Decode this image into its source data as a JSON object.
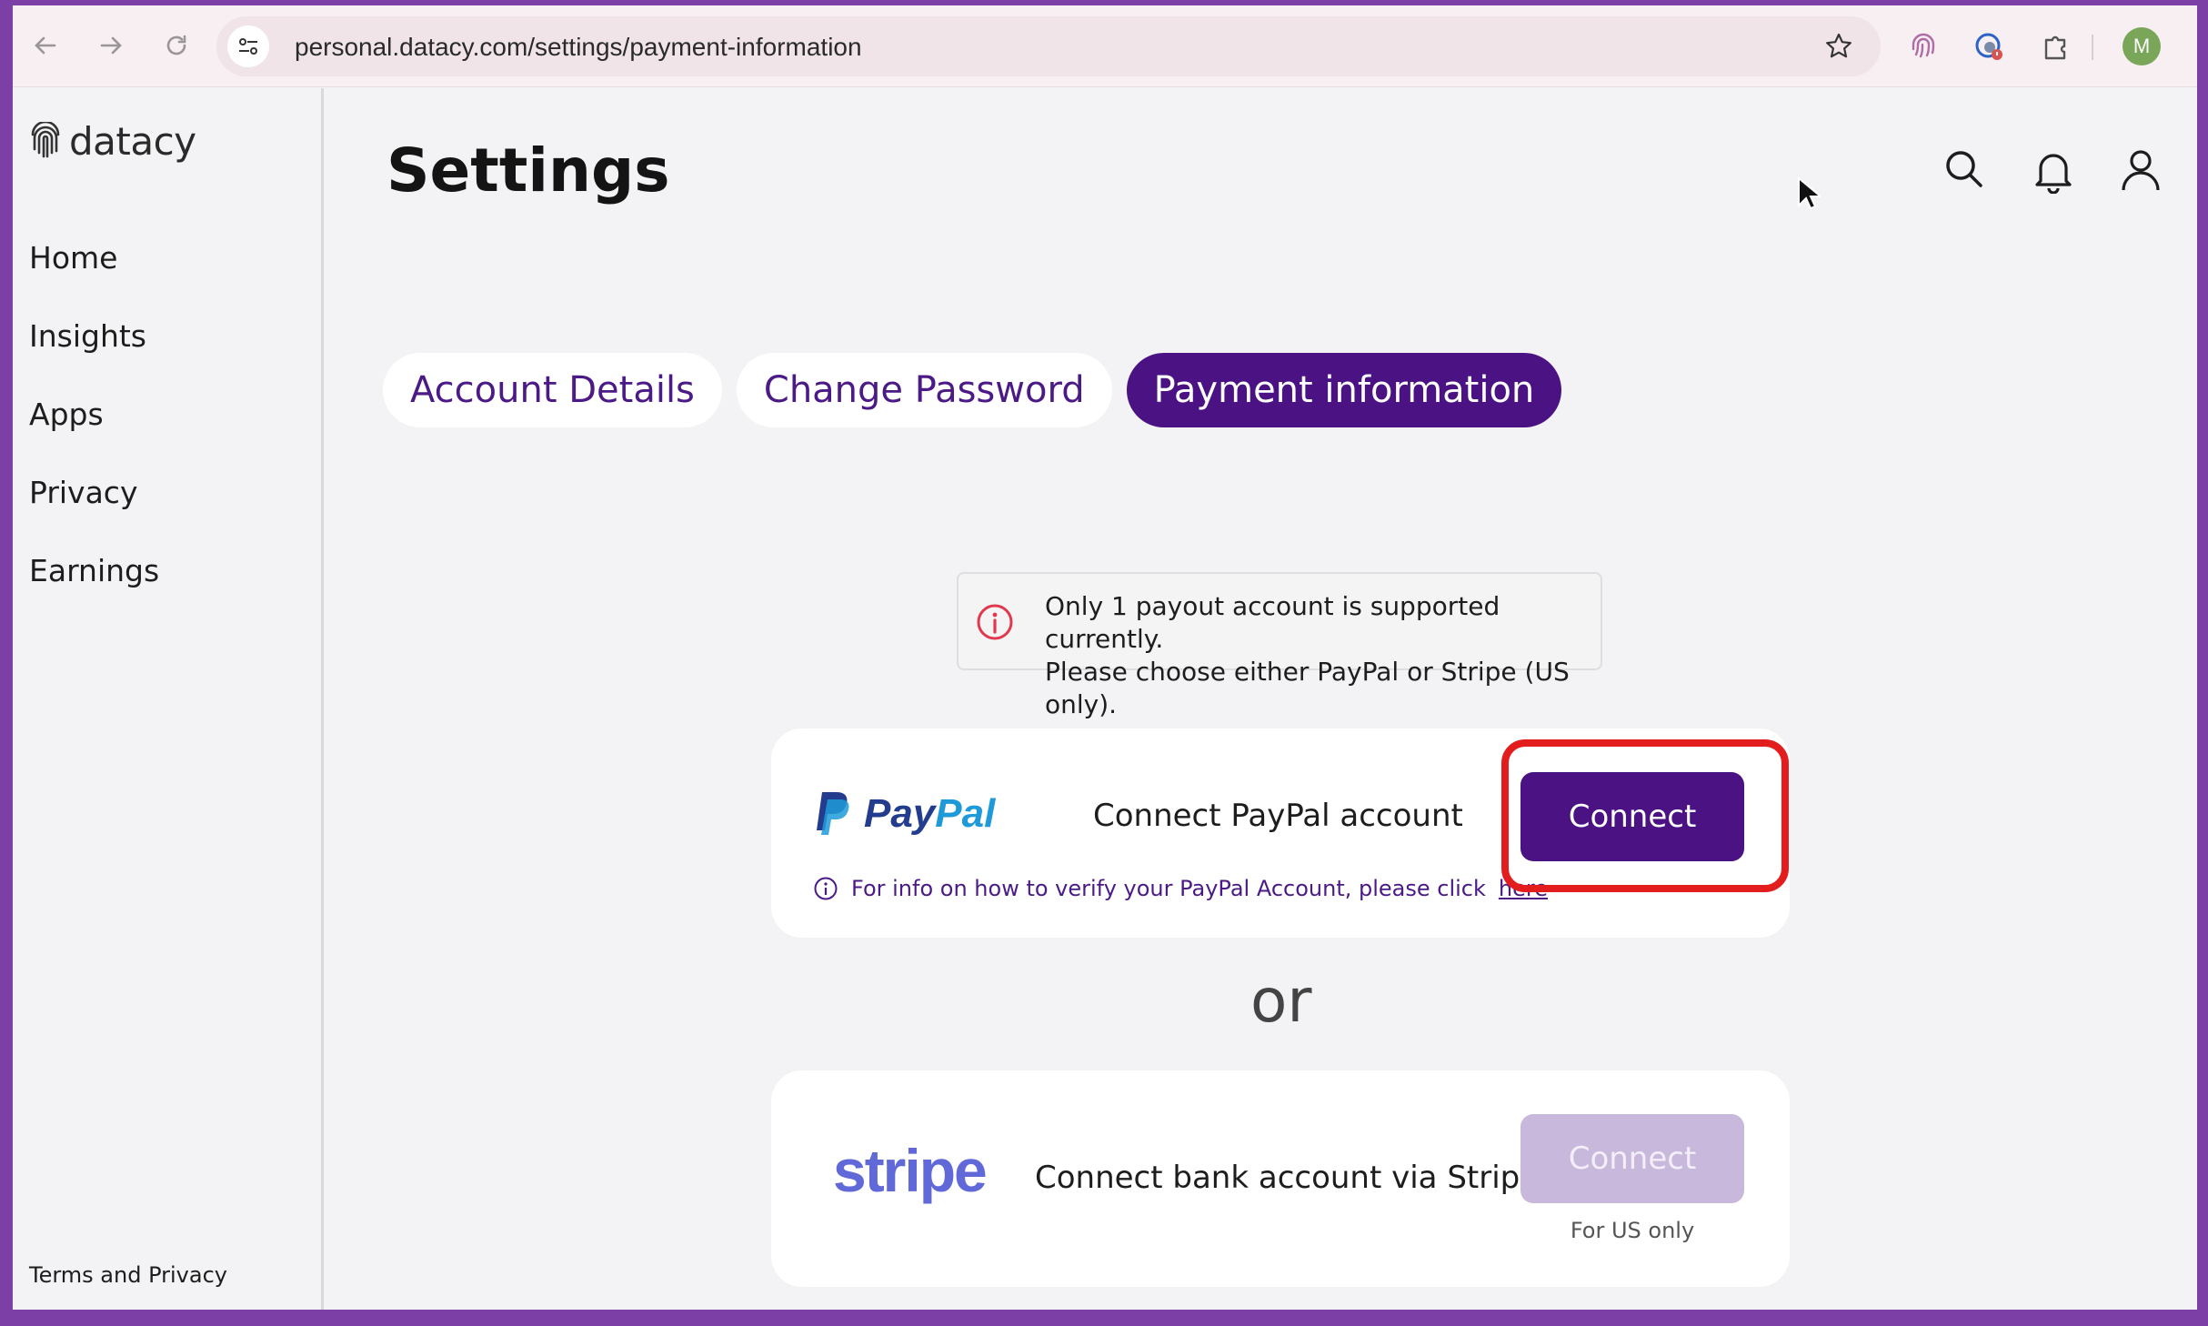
{
  "browser": {
    "url": "personal.datacy.com/settings/payment-information",
    "profile_initial": "M"
  },
  "app": {
    "logo_text": "datacy",
    "nav": [
      "Home",
      "Insights",
      "Apps",
      "Privacy",
      "Earnings"
    ],
    "footer_link": "Terms and Privacy"
  },
  "page": {
    "title": "Settings",
    "tabs": [
      {
        "label": "Account Details",
        "active": false
      },
      {
        "label": "Change Password",
        "active": false
      },
      {
        "label": "Payment information",
        "active": true
      }
    ]
  },
  "notice": {
    "line1": "Only 1 payout account is supported currently.",
    "line2": "Please choose either PayPal or Stripe (US only)."
  },
  "paypal": {
    "logo_pay": "Pay",
    "logo_pal": "Pal",
    "label": "Connect PayPal account",
    "button": "Connect",
    "info_text": "For info on how to verify your PayPal Account, please click",
    "info_link": "here"
  },
  "or_text": "or",
  "stripe": {
    "logo": "stripe",
    "label": "Connect bank account via Stripe",
    "button": "Connect",
    "note": "For US only"
  },
  "colors": {
    "brand_purple": "#4b1283",
    "disabled_button": "#c7b8dc",
    "highlight_red": "#e31d1d",
    "paypal_dark": "#233c8e",
    "paypal_light": "#1f9ad9",
    "stripe": "#6168d8"
  }
}
